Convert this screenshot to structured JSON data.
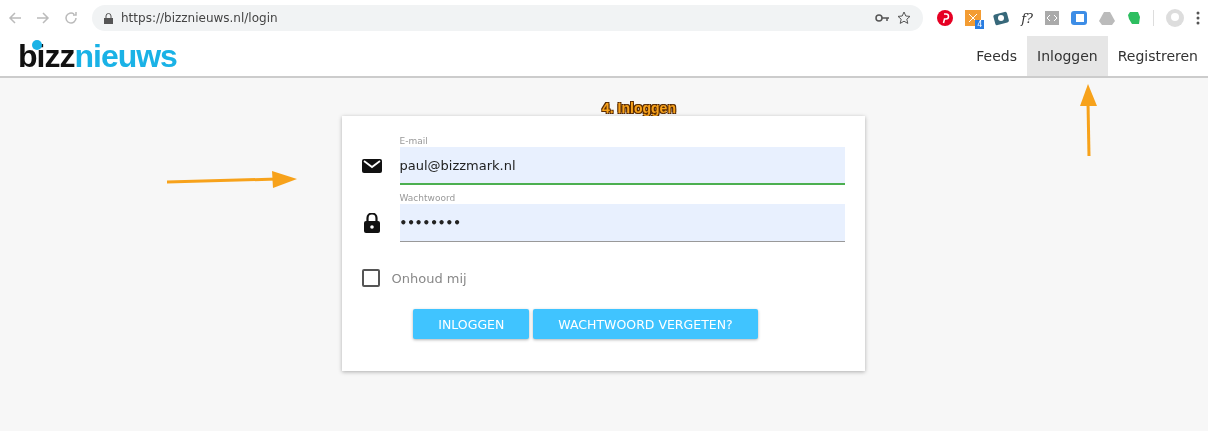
{
  "browser": {
    "url": "https://bizznieuws.nl/login",
    "extension_badge": "4",
    "extension_label": "f?"
  },
  "header": {
    "logo_dark": "bizz",
    "logo_light": "nieuws",
    "nav": [
      {
        "label": "Feeds",
        "selected": false
      },
      {
        "label": "Inloggen",
        "selected": true
      },
      {
        "label": "Registreren",
        "selected": false
      }
    ]
  },
  "annotation": "4. Inloggen",
  "form": {
    "fields": [
      {
        "kind": "email",
        "label": "E-mail",
        "value": "paul@bizzmark.nl",
        "focused": true
      },
      {
        "kind": "password",
        "label": "Wachtwoord",
        "value": "••••••••",
        "focused": false
      }
    ],
    "remember": {
      "label": "Onhoud mij",
      "checked": false
    },
    "buttons": [
      "INLOGGEN",
      "WACHTWOORD VERGETEN?"
    ]
  }
}
